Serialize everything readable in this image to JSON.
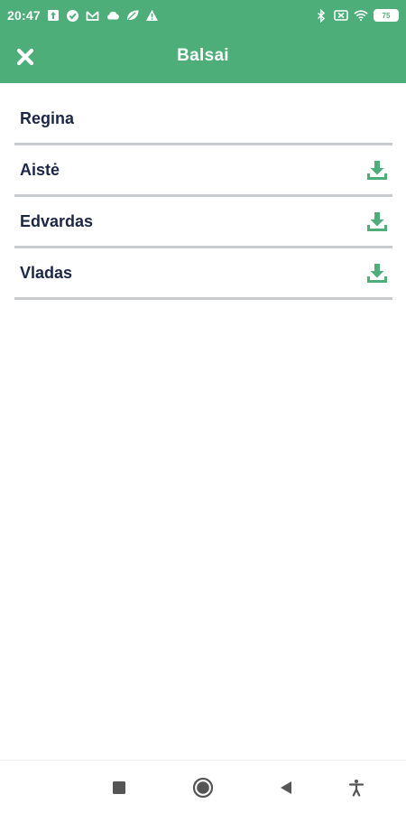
{
  "status_bar": {
    "time": "20:47",
    "battery_level": "75",
    "icons_left": [
      "upload-icon",
      "check-circle-icon",
      "mail-icon",
      "cloud-icon",
      "leaf-icon",
      "warning-icon"
    ],
    "icons_right": [
      "bluetooth-icon",
      "sim-off-icon",
      "wifi-icon",
      "battery-icon"
    ]
  },
  "app_bar": {
    "title": "Balsai",
    "close_icon": "close-icon"
  },
  "voices": [
    {
      "label": "Regina",
      "downloadable": false
    },
    {
      "label": "Aistė",
      "downloadable": true
    },
    {
      "label": "Edvardas",
      "downloadable": true
    },
    {
      "label": "Vladas",
      "downloadable": true
    }
  ],
  "nav_bar": {
    "icons": [
      "recents-square-icon",
      "home-circle-icon",
      "back-triangle-icon",
      "accessibility-icon"
    ]
  },
  "colors": {
    "accent": "#4eae7a",
    "text": "#1c2746",
    "divider": "#c8cbd0"
  }
}
